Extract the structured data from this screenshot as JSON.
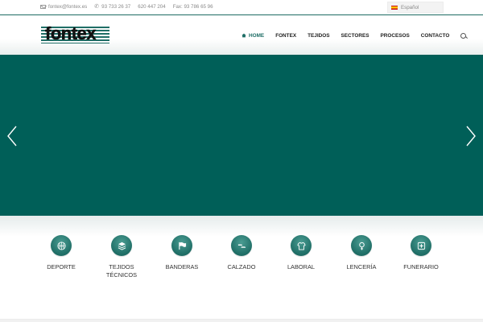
{
  "topbar": {
    "email": "fontex@fontex.es",
    "phone1": "93 733 26 37",
    "phone2": "620 447 204",
    "fax": "Fax: 93 786 65 96",
    "language": "Español"
  },
  "header": {
    "logo_text": "fontex",
    "nav": [
      {
        "label": "HOME",
        "active": true
      },
      {
        "label": "FONTEX",
        "active": false
      },
      {
        "label": "TEJIDOS",
        "active": false
      },
      {
        "label": "SECTORES",
        "active": false
      },
      {
        "label": "PROCESOS",
        "active": false
      },
      {
        "label": "CONTACTO",
        "active": false
      }
    ]
  },
  "hero": {
    "background_color": "#005f58"
  },
  "sectors": [
    {
      "label": "DEPORTE",
      "icon": "basketball-icon"
    },
    {
      "label": "TEJIDOS\nTÉCNICOS",
      "icon": "layers-icon"
    },
    {
      "label": "BANDERAS",
      "icon": "flag-icon"
    },
    {
      "label": "CALZADO",
      "icon": "shoes-icon"
    },
    {
      "label": "LABORAL",
      "icon": "shirt-icon"
    },
    {
      "label": "LENCERÍA",
      "icon": "female-icon"
    },
    {
      "label": "FUNERARIO",
      "icon": "cross-icon"
    }
  ],
  "colors": {
    "accent": "#1f6e66",
    "hero": "#005f58"
  }
}
